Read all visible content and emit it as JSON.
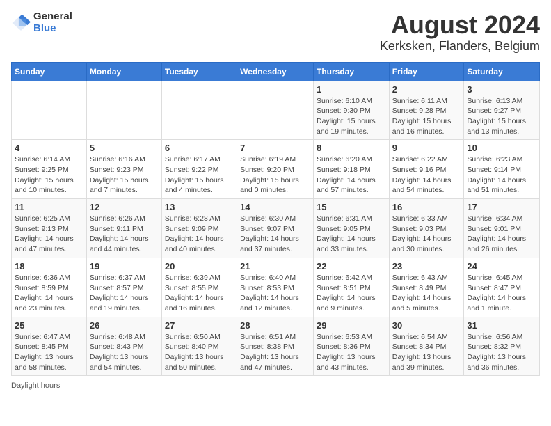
{
  "header": {
    "logo_general": "General",
    "logo_blue": "Blue",
    "title": "August 2024",
    "subtitle": "Kerksken, Flanders, Belgium"
  },
  "days_of_week": [
    "Sunday",
    "Monday",
    "Tuesday",
    "Wednesday",
    "Thursday",
    "Friday",
    "Saturday"
  ],
  "weeks": [
    [
      {
        "day": "",
        "info": ""
      },
      {
        "day": "",
        "info": ""
      },
      {
        "day": "",
        "info": ""
      },
      {
        "day": "",
        "info": ""
      },
      {
        "day": "1",
        "info": "Sunrise: 6:10 AM\nSunset: 9:30 PM\nDaylight: 15 hours and 19 minutes."
      },
      {
        "day": "2",
        "info": "Sunrise: 6:11 AM\nSunset: 9:28 PM\nDaylight: 15 hours and 16 minutes."
      },
      {
        "day": "3",
        "info": "Sunrise: 6:13 AM\nSunset: 9:27 PM\nDaylight: 15 hours and 13 minutes."
      }
    ],
    [
      {
        "day": "4",
        "info": "Sunrise: 6:14 AM\nSunset: 9:25 PM\nDaylight: 15 hours and 10 minutes."
      },
      {
        "day": "5",
        "info": "Sunrise: 6:16 AM\nSunset: 9:23 PM\nDaylight: 15 hours and 7 minutes."
      },
      {
        "day": "6",
        "info": "Sunrise: 6:17 AM\nSunset: 9:22 PM\nDaylight: 15 hours and 4 minutes."
      },
      {
        "day": "7",
        "info": "Sunrise: 6:19 AM\nSunset: 9:20 PM\nDaylight: 15 hours and 0 minutes."
      },
      {
        "day": "8",
        "info": "Sunrise: 6:20 AM\nSunset: 9:18 PM\nDaylight: 14 hours and 57 minutes."
      },
      {
        "day": "9",
        "info": "Sunrise: 6:22 AM\nSunset: 9:16 PM\nDaylight: 14 hours and 54 minutes."
      },
      {
        "day": "10",
        "info": "Sunrise: 6:23 AM\nSunset: 9:14 PM\nDaylight: 14 hours and 51 minutes."
      }
    ],
    [
      {
        "day": "11",
        "info": "Sunrise: 6:25 AM\nSunset: 9:13 PM\nDaylight: 14 hours and 47 minutes."
      },
      {
        "day": "12",
        "info": "Sunrise: 6:26 AM\nSunset: 9:11 PM\nDaylight: 14 hours and 44 minutes."
      },
      {
        "day": "13",
        "info": "Sunrise: 6:28 AM\nSunset: 9:09 PM\nDaylight: 14 hours and 40 minutes."
      },
      {
        "day": "14",
        "info": "Sunrise: 6:30 AM\nSunset: 9:07 PM\nDaylight: 14 hours and 37 minutes."
      },
      {
        "day": "15",
        "info": "Sunrise: 6:31 AM\nSunset: 9:05 PM\nDaylight: 14 hours and 33 minutes."
      },
      {
        "day": "16",
        "info": "Sunrise: 6:33 AM\nSunset: 9:03 PM\nDaylight: 14 hours and 30 minutes."
      },
      {
        "day": "17",
        "info": "Sunrise: 6:34 AM\nSunset: 9:01 PM\nDaylight: 14 hours and 26 minutes."
      }
    ],
    [
      {
        "day": "18",
        "info": "Sunrise: 6:36 AM\nSunset: 8:59 PM\nDaylight: 14 hours and 23 minutes."
      },
      {
        "day": "19",
        "info": "Sunrise: 6:37 AM\nSunset: 8:57 PM\nDaylight: 14 hours and 19 minutes."
      },
      {
        "day": "20",
        "info": "Sunrise: 6:39 AM\nSunset: 8:55 PM\nDaylight: 14 hours and 16 minutes."
      },
      {
        "day": "21",
        "info": "Sunrise: 6:40 AM\nSunset: 8:53 PM\nDaylight: 14 hours and 12 minutes."
      },
      {
        "day": "22",
        "info": "Sunrise: 6:42 AM\nSunset: 8:51 PM\nDaylight: 14 hours and 9 minutes."
      },
      {
        "day": "23",
        "info": "Sunrise: 6:43 AM\nSunset: 8:49 PM\nDaylight: 14 hours and 5 minutes."
      },
      {
        "day": "24",
        "info": "Sunrise: 6:45 AM\nSunset: 8:47 PM\nDaylight: 14 hours and 1 minute."
      }
    ],
    [
      {
        "day": "25",
        "info": "Sunrise: 6:47 AM\nSunset: 8:45 PM\nDaylight: 13 hours and 58 minutes."
      },
      {
        "day": "26",
        "info": "Sunrise: 6:48 AM\nSunset: 8:43 PM\nDaylight: 13 hours and 54 minutes."
      },
      {
        "day": "27",
        "info": "Sunrise: 6:50 AM\nSunset: 8:40 PM\nDaylight: 13 hours and 50 minutes."
      },
      {
        "day": "28",
        "info": "Sunrise: 6:51 AM\nSunset: 8:38 PM\nDaylight: 13 hours and 47 minutes."
      },
      {
        "day": "29",
        "info": "Sunrise: 6:53 AM\nSunset: 8:36 PM\nDaylight: 13 hours and 43 minutes."
      },
      {
        "day": "30",
        "info": "Sunrise: 6:54 AM\nSunset: 8:34 PM\nDaylight: 13 hours and 39 minutes."
      },
      {
        "day": "31",
        "info": "Sunrise: 6:56 AM\nSunset: 8:32 PM\nDaylight: 13 hours and 36 minutes."
      }
    ]
  ],
  "footer": {
    "daylight_hours": "Daylight hours"
  }
}
